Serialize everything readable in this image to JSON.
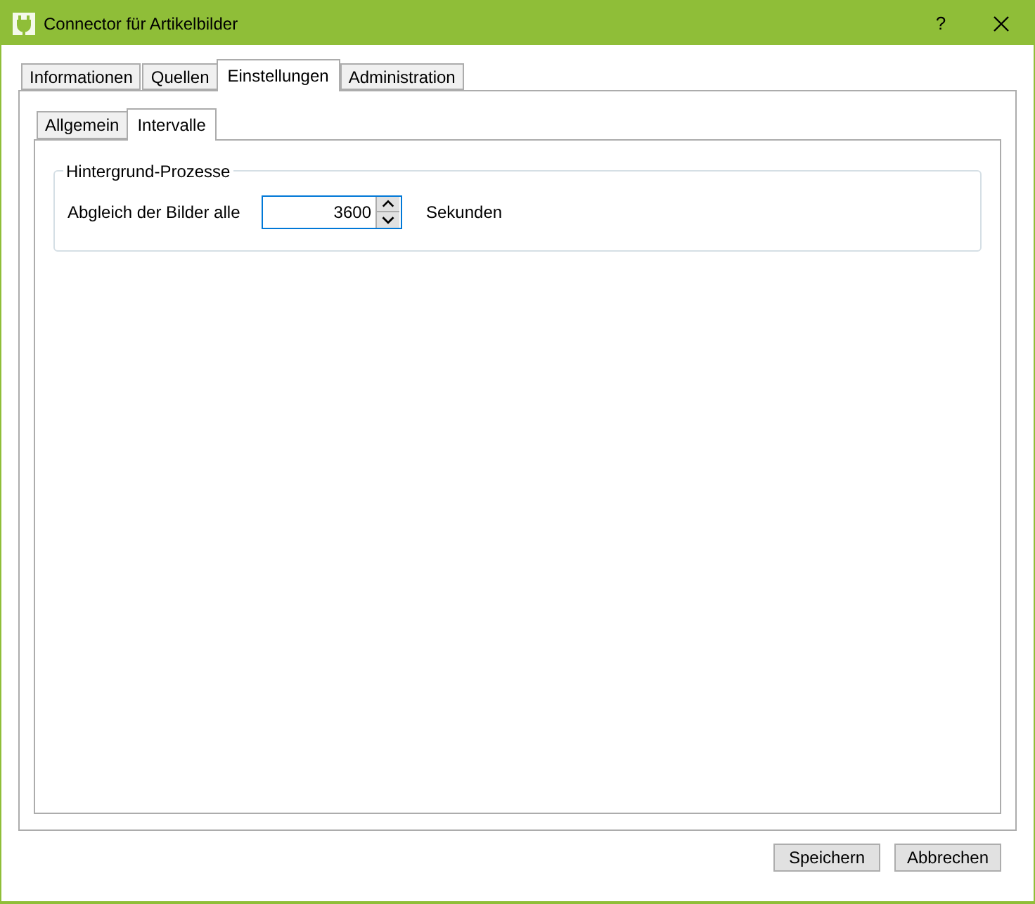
{
  "window": {
    "title": "Connector für Artikelbilder",
    "help": "?"
  },
  "tabs": [
    {
      "label": "Informationen",
      "selected": false
    },
    {
      "label": "Quellen",
      "selected": false
    },
    {
      "label": "Einstellungen",
      "selected": true
    },
    {
      "label": "Administration",
      "selected": false
    }
  ],
  "subtabs": [
    {
      "label": "Allgemein",
      "selected": false
    },
    {
      "label": "Intervalle",
      "selected": true
    }
  ],
  "group": {
    "title": "Hintergrund-Prozesse",
    "label": "Abgleich der Bilder alle",
    "value": "3600",
    "unit": "Sekunden"
  },
  "buttons": [
    "Speichern",
    "Abbrechen"
  ]
}
